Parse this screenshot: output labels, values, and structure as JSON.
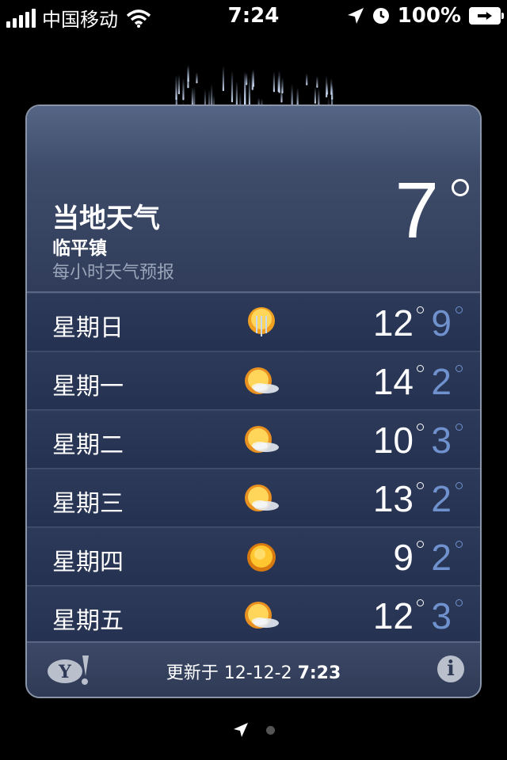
{
  "status_bar": {
    "carrier": "中国移动",
    "time": "7:24",
    "battery": "100%",
    "icons": [
      "signal-icon",
      "wifi-icon",
      "location-icon",
      "alarm-icon",
      "battery-icon"
    ]
  },
  "location": {
    "title": "当地天气",
    "city": "临平镇",
    "subtitle": "每小时天气预报",
    "current_temp": "7",
    "condition_icon": "rain-icon"
  },
  "forecast": [
    {
      "day": "星期日",
      "icon": "rain-sun-icon",
      "high": "12",
      "low": "9"
    },
    {
      "day": "星期一",
      "icon": "partly-cloudy-icon",
      "high": "14",
      "low": "2"
    },
    {
      "day": "星期二",
      "icon": "partly-cloudy-icon",
      "high": "10",
      "low": "3"
    },
    {
      "day": "星期三",
      "icon": "partly-cloudy-icon",
      "high": "13",
      "low": "2"
    },
    {
      "day": "星期四",
      "icon": "sunny-icon",
      "high": "9",
      "low": "2"
    },
    {
      "day": "星期五",
      "icon": "partly-cloudy-icon",
      "high": "12",
      "low": "3"
    }
  ],
  "footer": {
    "updated_label": "更新于",
    "updated_date": "12-12-2",
    "updated_time": "7:23",
    "yahoo_logo": "yahoo-logo",
    "info_glyph": "i"
  },
  "colors": {
    "low_temp": "#6f92cf",
    "card_bg": "#2a3550"
  }
}
